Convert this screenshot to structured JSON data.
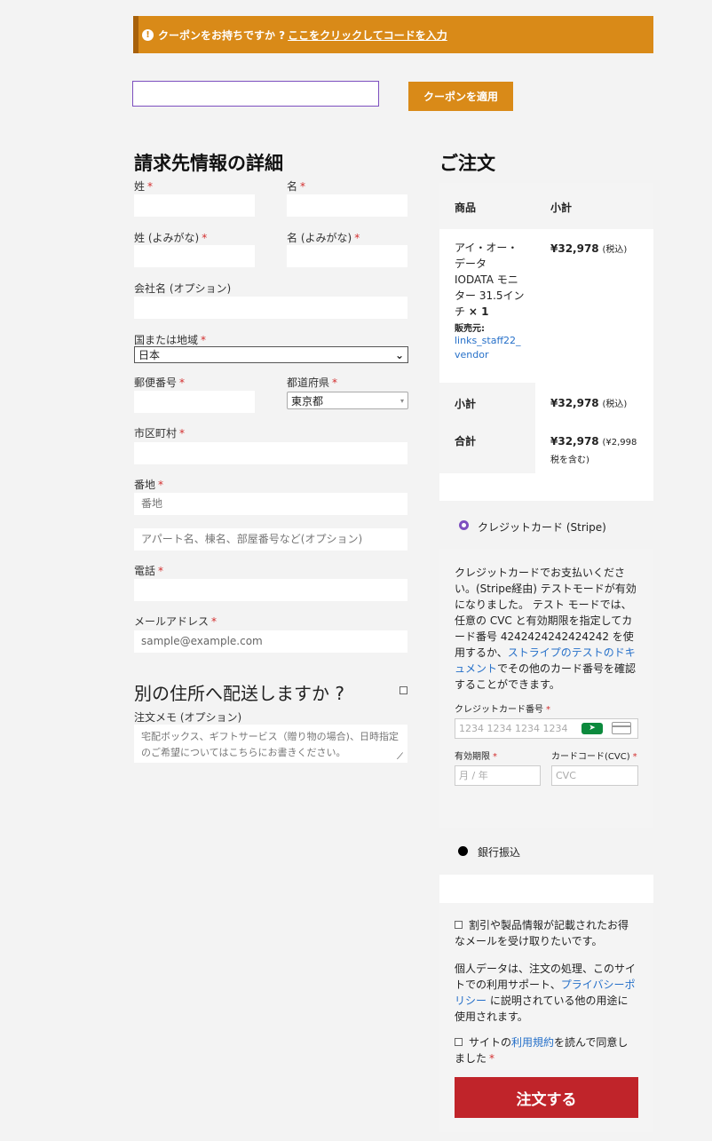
{
  "notice": {
    "text": "クーポンをお持ちですか ?",
    "link": "ここをクリックしてコードを入力"
  },
  "coupon": {
    "button": "クーポンを適用"
  },
  "billing": {
    "title": "請求先情報の詳細",
    "last_name": "姓",
    "first_name": "名",
    "last_name_kana": "姓 (よみがな)",
    "first_name_kana": "名 (よみがな)",
    "company": "会社名 (オプション)",
    "country_label": "国または地域",
    "country_value": "日本",
    "postcode": "郵便番号",
    "state_label": "都道府県",
    "state_value": "東京都",
    "city": "市区町村",
    "address_label": "番地",
    "address_placeholder": "番地",
    "address2_placeholder": "アパート名、棟名、部屋番号など(オプション)",
    "phone": "電話",
    "email_label": "メールアドレス",
    "email_placeholder": "sample@example.com",
    "ship_different": "別の住所へ配送しますか ?",
    "notes_label": "注文メモ (オプション)",
    "notes_placeholder": "宅配ボックス、ギフトサービス（贈り物の場合)、日時指定のご希望についてはこちらにお書きください。"
  },
  "order": {
    "title": "ご注文",
    "col_product": "商品",
    "col_subtotal": "小計",
    "product_name": "アイ・オー・データ IODATA モニター 31.5インチ",
    "qty": "× 1",
    "vendor_label": "販売元:",
    "vendor_name": "links_staff22_vendor",
    "product_price": "¥32,978",
    "tax_incl": "(税込)",
    "subtotal_label": "小計",
    "subtotal_value": "¥32,978",
    "total_label": "合計",
    "total_value": "¥32,978",
    "total_tax": "(¥2,998 税を含む)"
  },
  "payment": {
    "stripe_label": "クレジットカード (Stripe)",
    "stripe_desc_1": "クレジットカードでお支払いください。(Stripe経由) テストモードが有効になりました。 テスト モードでは、任意の CVC と有効期限を指定してカード番号 4242424242424242 を使用するか、",
    "stripe_desc_link": "ストライプのテストのドキュメント",
    "stripe_desc_2": "でその他のカード番号を確認することができます。",
    "card_number_label": "クレジットカード番号",
    "card_number_placeholder": "1234 1234 1234 1234",
    "expiry_label": "有効期限",
    "expiry_placeholder": "月 / 年",
    "cvc_label": "カードコード(CVC)",
    "cvc_placeholder": "CVC",
    "bank_label": "銀行振込"
  },
  "consent": {
    "newsletter": "割引や製品情報が記載されたお得なメールを受け取りたいです。",
    "privacy_1": "個人データは、注文の処理、このサイトでの利用サポート、",
    "privacy_link": "プライバシーポリシー",
    "privacy_2": " に説明されている他の用途に使用されます。",
    "terms_1": "サイトの",
    "terms_link": "利用規約",
    "terms_2": "を読んで同意しました",
    "place_order": "注文する"
  },
  "colors": {
    "accent": "#d98a18",
    "order_button": "#c0242a",
    "link": "#2670c9",
    "radio": "#7d4fbf"
  }
}
